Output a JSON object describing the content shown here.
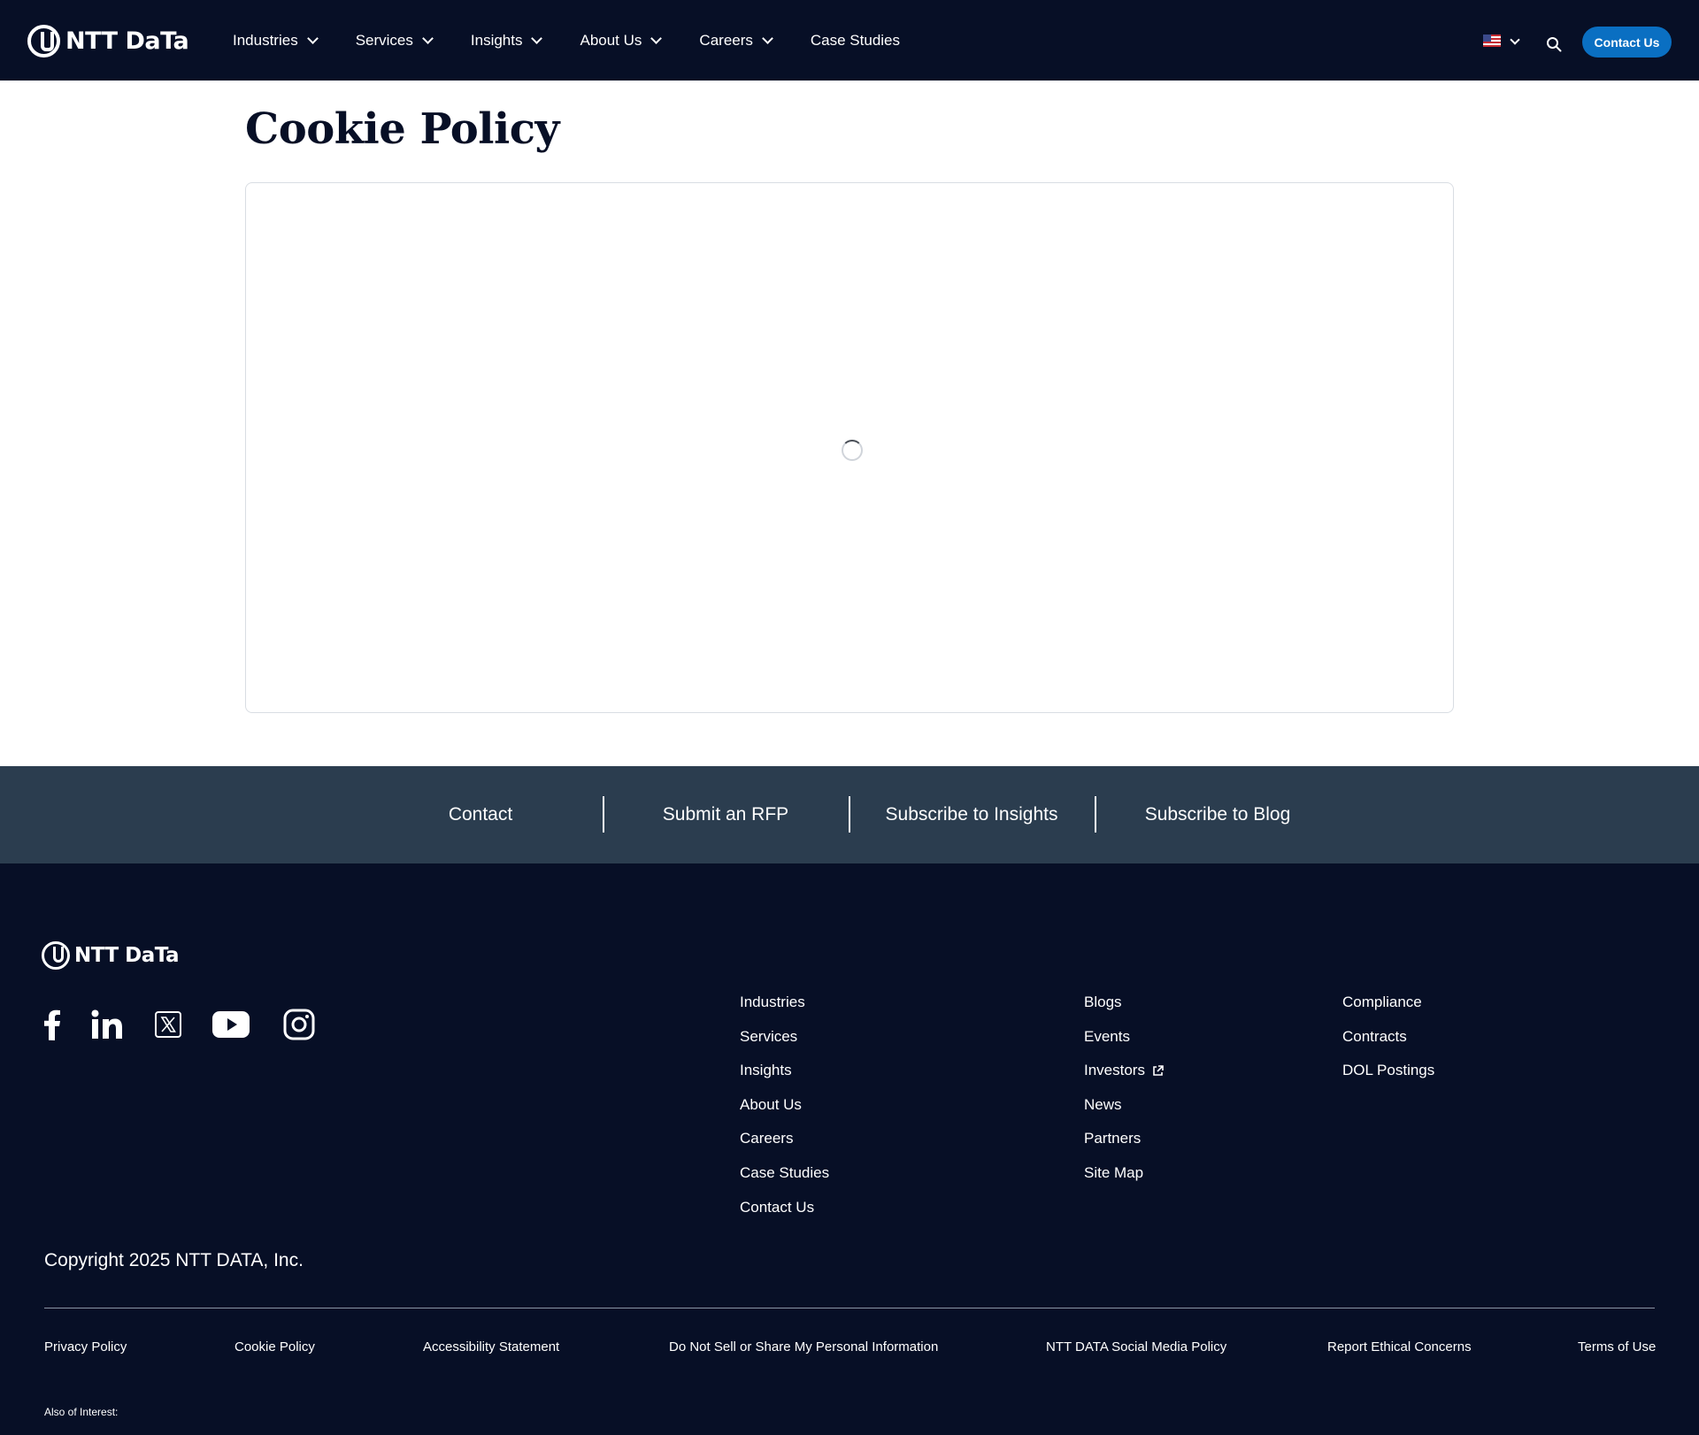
{
  "header": {
    "logo_text": "NTT DaTa",
    "nav": [
      {
        "label": "Industries",
        "has_dropdown": true
      },
      {
        "label": "Services",
        "has_dropdown": true
      },
      {
        "label": "Insights",
        "has_dropdown": true
      },
      {
        "label": "About Us",
        "has_dropdown": true
      },
      {
        "label": "Careers",
        "has_dropdown": true
      },
      {
        "label": "Case Studies",
        "has_dropdown": false
      }
    ],
    "language_flag": "us-flag-icon",
    "contact_label": "Contact Us",
    "accent_color": "#0a6fc2",
    "bg_color": "#070f26"
  },
  "main": {
    "title": "Cookie Policy",
    "loading": true
  },
  "cta": {
    "items": [
      "Contact",
      "Submit an RFP",
      "Subscribe to Insights",
      "Subscribe to Blog"
    ],
    "bg_color": "#2b3d4f"
  },
  "footer": {
    "logo_text": "NTT DaTa",
    "social": [
      "facebook-icon",
      "linkedin-icon",
      "x-icon",
      "youtube-icon",
      "instagram-icon"
    ],
    "col1": [
      "Industries",
      "Services",
      "Insights",
      "About Us",
      "Careers",
      "Case Studies",
      "Contact Us"
    ],
    "col2": [
      "Blogs",
      "Events",
      "Investors",
      "News",
      "Partners",
      "Site Map"
    ],
    "col3": [
      "Compliance",
      "Contracts",
      "DOL Postings"
    ],
    "copyright": "Copyright 2025 NTT DATA, Inc.",
    "legal": [
      "Privacy Policy",
      "Cookie Policy",
      "Accessibility Statement",
      "Do Not Sell or Share My Personal Information",
      "NTT DATA Social Media Policy",
      "Report Ethical Concerns",
      "Terms of Use"
    ],
    "also_of_interest": "Also of Interest:"
  }
}
